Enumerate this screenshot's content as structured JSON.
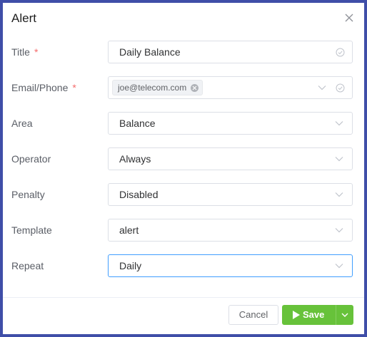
{
  "dialog": {
    "title": "Alert",
    "close_icon": "close-icon"
  },
  "form": {
    "title": {
      "label": "Title",
      "required": "*",
      "value": "Daily Balance"
    },
    "email_phone": {
      "label": "Email/Phone",
      "required": "*",
      "tags": [
        "joe@telecom.com"
      ]
    },
    "area": {
      "label": "Area",
      "value": "Balance"
    },
    "operator": {
      "label": "Operator",
      "value": "Always"
    },
    "penalty": {
      "label": "Penalty",
      "value": "Disabled"
    },
    "template": {
      "label": "Template",
      "value": "alert"
    },
    "repeat": {
      "label": "Repeat",
      "value": "Daily"
    }
  },
  "footer": {
    "cancel_label": "Cancel",
    "save_label": "Save"
  },
  "colors": {
    "frame": "#3f4ea8",
    "save": "#67c23a",
    "required": "#f56c6c",
    "focus": "#409eff"
  }
}
